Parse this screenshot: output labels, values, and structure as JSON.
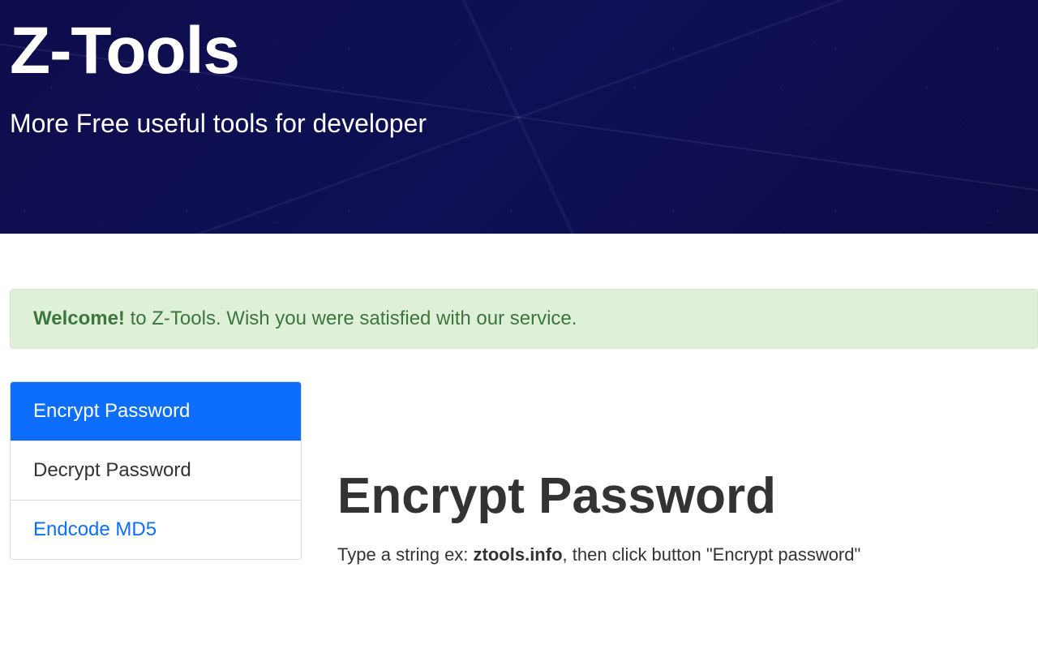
{
  "header": {
    "title": "Z-Tools",
    "subtitle": "More Free useful tools for developer"
  },
  "alert": {
    "welcome_bold": "Welcome!",
    "welcome_text": " to Z-Tools. Wish you were satisfied with our service."
  },
  "sidebar": {
    "items": [
      {
        "label": "Encrypt Password",
        "active": true
      },
      {
        "label": "Decrypt Password",
        "active": false
      },
      {
        "label": "Endcode MD5",
        "active": false
      }
    ]
  },
  "main": {
    "title": "Encrypt Password",
    "instruction_prefix": "Type a string ex: ",
    "instruction_bold": "ztools.info",
    "instruction_suffix": ", then click button \"Encrypt password\""
  }
}
